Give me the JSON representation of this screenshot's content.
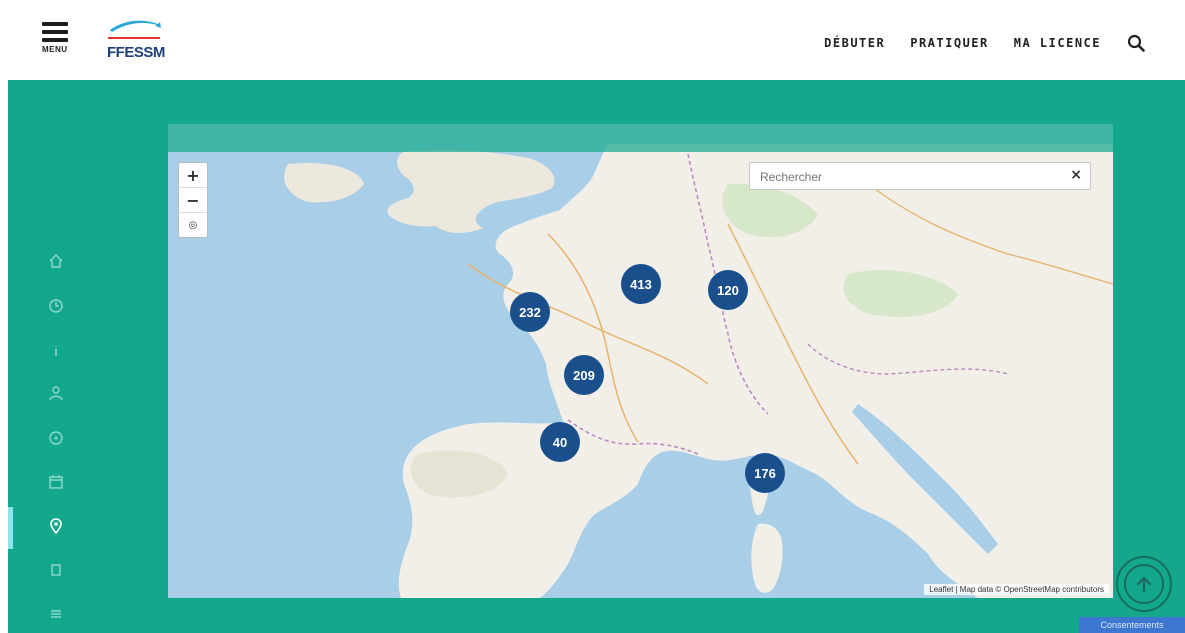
{
  "header": {
    "menu_label": "MENU",
    "logo_text": "FFESSM",
    "nav": [
      {
        "label": "DÉBUTER"
      },
      {
        "label": "PRATIQUER"
      },
      {
        "label": "MA LICENCE"
      }
    ],
    "search_icon": "search-icon"
  },
  "side_rail": {
    "icons": [
      "home-icon",
      "clock-icon",
      "info-icon",
      "user-icon",
      "compass-icon",
      "calendar-icon",
      "location-pin-icon",
      "document-icon",
      "list-icon"
    ],
    "active_index": 6
  },
  "map": {
    "info_text": "",
    "search_placeholder": "Rechercher",
    "zoom_in": "+",
    "zoom_out": "−",
    "locate": "◎",
    "clear": "×",
    "attribution": "Leaflet | Map data © OpenStreetMap contributors",
    "clusters": [
      {
        "count": "413"
      },
      {
        "count": "120"
      },
      {
        "count": "232"
      },
      {
        "count": "209"
      },
      {
        "count": "40"
      },
      {
        "count": "176"
      }
    ]
  },
  "cookie_label": "Consentements",
  "colors": {
    "teal": "#13a88b",
    "cluster": "#1a4f8c",
    "brand_blue": "#1e3f7a"
  }
}
